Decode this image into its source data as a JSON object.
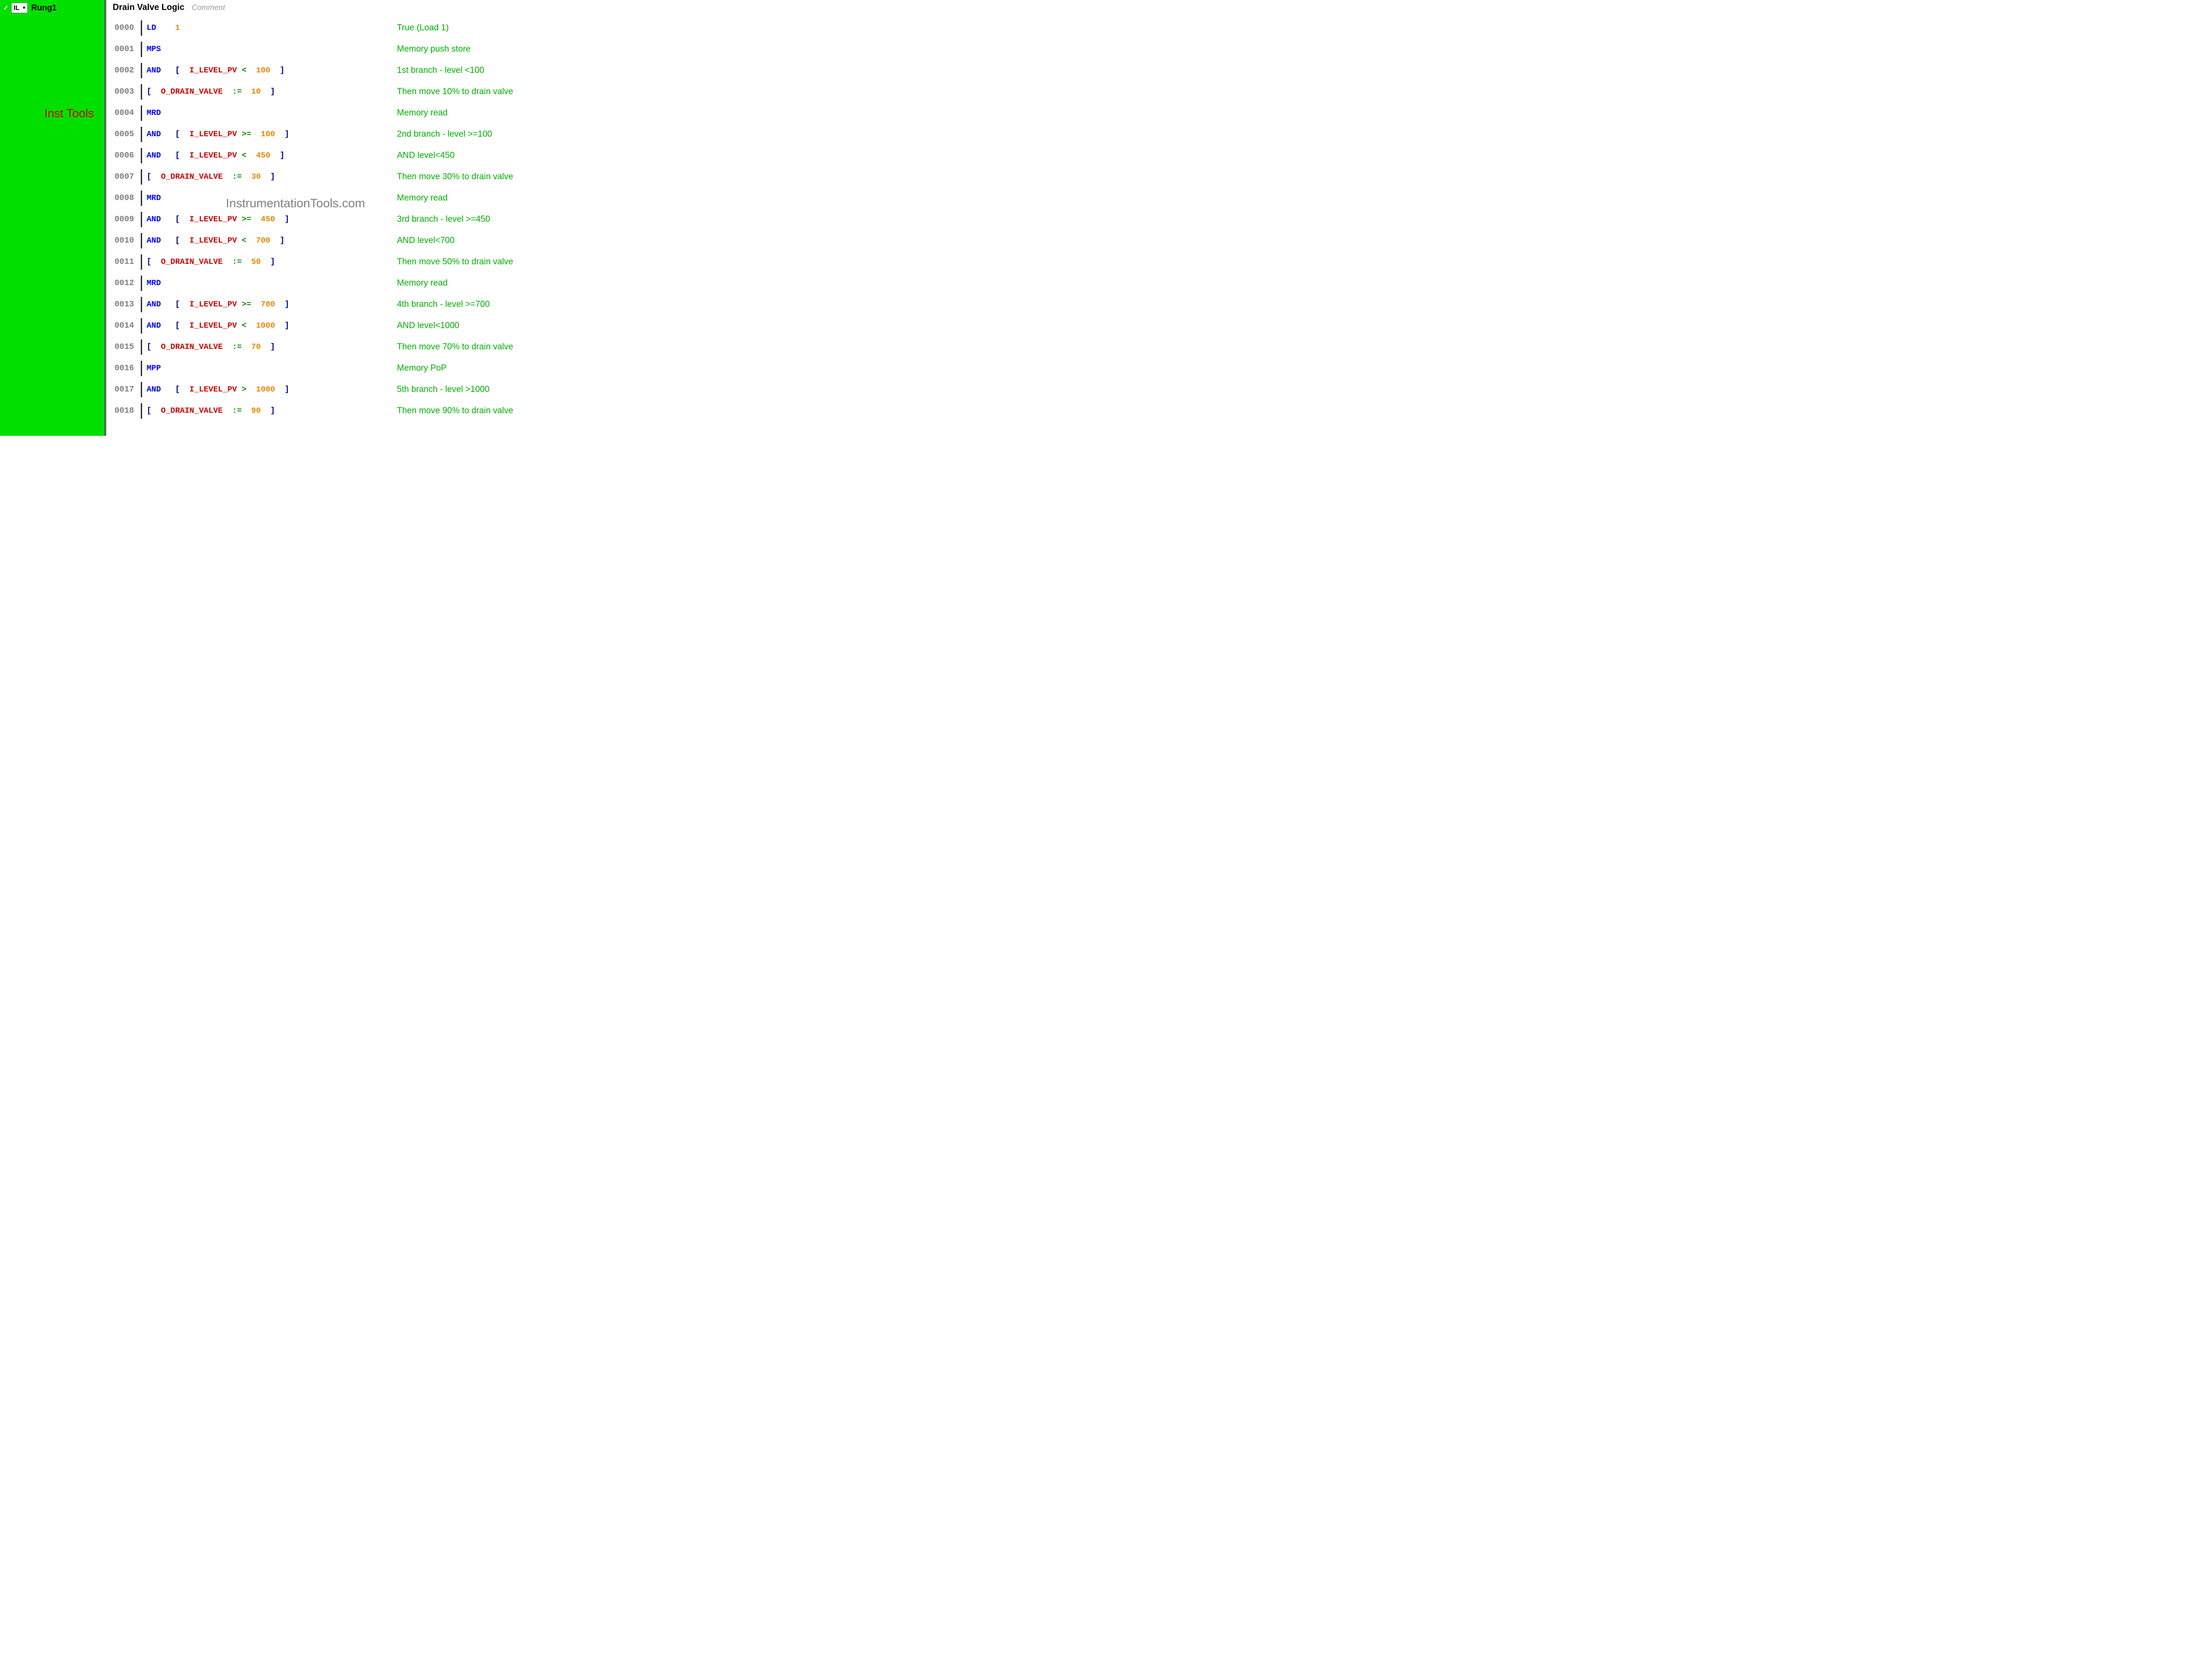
{
  "sidebar": {
    "check": "✓",
    "language": "IL",
    "rung_label": "Rung1",
    "watermark": "Inst Tools"
  },
  "header": {
    "title": "Drain Valve Logic",
    "comment_placeholder": "Comment"
  },
  "main_watermark": "InstrumentationTools.com",
  "lines": [
    {
      "num": "0000",
      "tokens": [
        {
          "type": "blue",
          "text": "LD"
        },
        {
          "type": "sp",
          "text": "    "
        },
        {
          "type": "orange",
          "text": "1"
        }
      ],
      "comment": "True (Load 1)"
    },
    {
      "num": "0001",
      "tokens": [
        {
          "type": "blue",
          "text": "MPS"
        }
      ],
      "comment": "Memory push store"
    },
    {
      "num": "0002",
      "tokens": [
        {
          "type": "blue",
          "text": "AND"
        },
        {
          "type": "sp",
          "text": "   "
        },
        {
          "type": "navy",
          "text": "[  "
        },
        {
          "type": "red",
          "text": "I_LEVEL_PV"
        },
        {
          "type": "sp",
          "text": " "
        },
        {
          "type": "green",
          "text": "<"
        },
        {
          "type": "sp",
          "text": "  "
        },
        {
          "type": "orange",
          "text": "100"
        },
        {
          "type": "sp",
          "text": "  "
        },
        {
          "type": "navy",
          "text": "]"
        }
      ],
      "comment": "1st branch - level <100"
    },
    {
      "num": "0003",
      "tokens": [
        {
          "type": "navy",
          "text": "[  "
        },
        {
          "type": "red",
          "text": "O_DRAIN_VALVE"
        },
        {
          "type": "sp",
          "text": "  "
        },
        {
          "type": "green",
          "text": ":="
        },
        {
          "type": "sp",
          "text": "  "
        },
        {
          "type": "orange",
          "text": "10"
        },
        {
          "type": "sp",
          "text": "  "
        },
        {
          "type": "navy",
          "text": "]"
        }
      ],
      "comment": "Then move 10% to drain valve"
    },
    {
      "num": "0004",
      "tokens": [
        {
          "type": "blue",
          "text": "MRD"
        }
      ],
      "comment": "Memory read"
    },
    {
      "num": "0005",
      "tokens": [
        {
          "type": "blue",
          "text": "AND"
        },
        {
          "type": "sp",
          "text": "   "
        },
        {
          "type": "navy",
          "text": "[  "
        },
        {
          "type": "red",
          "text": "I_LEVEL_PV"
        },
        {
          "type": "sp",
          "text": " "
        },
        {
          "type": "green",
          "text": ">="
        },
        {
          "type": "sp",
          "text": "  "
        },
        {
          "type": "orange",
          "text": "100"
        },
        {
          "type": "sp",
          "text": "  "
        },
        {
          "type": "navy",
          "text": "]"
        }
      ],
      "comment": "2nd branch - level >=100"
    },
    {
      "num": "0006",
      "tokens": [
        {
          "type": "blue",
          "text": "AND"
        },
        {
          "type": "sp",
          "text": "   "
        },
        {
          "type": "navy",
          "text": "[  "
        },
        {
          "type": "red",
          "text": "I_LEVEL_PV"
        },
        {
          "type": "sp",
          "text": " "
        },
        {
          "type": "green",
          "text": "<"
        },
        {
          "type": "sp",
          "text": "  "
        },
        {
          "type": "orange",
          "text": "450"
        },
        {
          "type": "sp",
          "text": "  "
        },
        {
          "type": "navy",
          "text": "]"
        }
      ],
      "comment": "AND level<450"
    },
    {
      "num": "0007",
      "tokens": [
        {
          "type": "navy",
          "text": "[  "
        },
        {
          "type": "red",
          "text": "O_DRAIN_VALVE"
        },
        {
          "type": "sp",
          "text": "  "
        },
        {
          "type": "green",
          "text": ":="
        },
        {
          "type": "sp",
          "text": "  "
        },
        {
          "type": "orange",
          "text": "30"
        },
        {
          "type": "sp",
          "text": "  "
        },
        {
          "type": "navy",
          "text": "]"
        }
      ],
      "comment": "Then move 30% to drain valve"
    },
    {
      "num": "0008",
      "tokens": [
        {
          "type": "blue",
          "text": "MRD"
        }
      ],
      "comment": "Memory read"
    },
    {
      "num": "0009",
      "tokens": [
        {
          "type": "blue",
          "text": "AND"
        },
        {
          "type": "sp",
          "text": "   "
        },
        {
          "type": "navy",
          "text": "[  "
        },
        {
          "type": "red",
          "text": "I_LEVEL_PV"
        },
        {
          "type": "sp",
          "text": " "
        },
        {
          "type": "green",
          "text": ">="
        },
        {
          "type": "sp",
          "text": "  "
        },
        {
          "type": "orange",
          "text": "450"
        },
        {
          "type": "sp",
          "text": "  "
        },
        {
          "type": "navy",
          "text": "]"
        }
      ],
      "comment": "3rd branch - level >=450"
    },
    {
      "num": "0010",
      "tokens": [
        {
          "type": "blue",
          "text": "AND"
        },
        {
          "type": "sp",
          "text": "   "
        },
        {
          "type": "navy",
          "text": "[  "
        },
        {
          "type": "red",
          "text": "I_LEVEL_PV"
        },
        {
          "type": "sp",
          "text": " "
        },
        {
          "type": "green",
          "text": "<"
        },
        {
          "type": "sp",
          "text": "  "
        },
        {
          "type": "orange",
          "text": "700"
        },
        {
          "type": "sp",
          "text": "  "
        },
        {
          "type": "navy",
          "text": "]"
        }
      ],
      "comment": "AND level<700"
    },
    {
      "num": "0011",
      "tokens": [
        {
          "type": "navy",
          "text": "[  "
        },
        {
          "type": "red",
          "text": "O_DRAIN_VALVE"
        },
        {
          "type": "sp",
          "text": "  "
        },
        {
          "type": "green",
          "text": ":="
        },
        {
          "type": "sp",
          "text": "  "
        },
        {
          "type": "orange",
          "text": "50"
        },
        {
          "type": "sp",
          "text": "  "
        },
        {
          "type": "navy",
          "text": "]"
        }
      ],
      "comment": "Then move 50% to drain valve"
    },
    {
      "num": "0012",
      "tokens": [
        {
          "type": "blue",
          "text": "MRD"
        }
      ],
      "comment": "Memory read"
    },
    {
      "num": "0013",
      "tokens": [
        {
          "type": "blue",
          "text": "AND"
        },
        {
          "type": "sp",
          "text": "   "
        },
        {
          "type": "navy",
          "text": "[  "
        },
        {
          "type": "red",
          "text": "I_LEVEL_PV"
        },
        {
          "type": "sp",
          "text": " "
        },
        {
          "type": "green",
          "text": ">="
        },
        {
          "type": "sp",
          "text": "  "
        },
        {
          "type": "orange",
          "text": "700"
        },
        {
          "type": "sp",
          "text": "  "
        },
        {
          "type": "navy",
          "text": "]"
        }
      ],
      "comment": "4th branch - level >=700"
    },
    {
      "num": "0014",
      "tokens": [
        {
          "type": "blue",
          "text": "AND"
        },
        {
          "type": "sp",
          "text": "   "
        },
        {
          "type": "navy",
          "text": "[  "
        },
        {
          "type": "red",
          "text": "I_LEVEL_PV"
        },
        {
          "type": "sp",
          "text": " "
        },
        {
          "type": "green",
          "text": "<"
        },
        {
          "type": "sp",
          "text": "  "
        },
        {
          "type": "orange",
          "text": "1000"
        },
        {
          "type": "sp",
          "text": "  "
        },
        {
          "type": "navy",
          "text": "]"
        }
      ],
      "comment": "AND level<1000"
    },
    {
      "num": "0015",
      "tokens": [
        {
          "type": "navy",
          "text": "[  "
        },
        {
          "type": "red",
          "text": "O_DRAIN_VALVE"
        },
        {
          "type": "sp",
          "text": "  "
        },
        {
          "type": "green",
          "text": ":="
        },
        {
          "type": "sp",
          "text": "  "
        },
        {
          "type": "orange",
          "text": "70"
        },
        {
          "type": "sp",
          "text": "  "
        },
        {
          "type": "navy",
          "text": "]"
        }
      ],
      "comment": "Then move 70% to drain valve"
    },
    {
      "num": "0016",
      "tokens": [
        {
          "type": "blue",
          "text": "MPP"
        }
      ],
      "comment": "Memory PoP"
    },
    {
      "num": "0017",
      "tokens": [
        {
          "type": "blue",
          "text": "AND"
        },
        {
          "type": "sp",
          "text": "   "
        },
        {
          "type": "navy",
          "text": "[  "
        },
        {
          "type": "red",
          "text": "I_LEVEL_PV"
        },
        {
          "type": "sp",
          "text": " "
        },
        {
          "type": "green",
          "text": ">"
        },
        {
          "type": "sp",
          "text": "  "
        },
        {
          "type": "orange",
          "text": "1000"
        },
        {
          "type": "sp",
          "text": "  "
        },
        {
          "type": "navy",
          "text": "]"
        }
      ],
      "comment": "5th branch - level >1000"
    },
    {
      "num": "0018",
      "tokens": [
        {
          "type": "navy",
          "text": "[  "
        },
        {
          "type": "red",
          "text": "O_DRAIN_VALVE"
        },
        {
          "type": "sp",
          "text": "  "
        },
        {
          "type": "green",
          "text": ":="
        },
        {
          "type": "sp",
          "text": "  "
        },
        {
          "type": "orange",
          "text": "90"
        },
        {
          "type": "sp",
          "text": "  "
        },
        {
          "type": "navy",
          "text": "]"
        }
      ],
      "comment": "Then move 90% to drain valve"
    }
  ]
}
